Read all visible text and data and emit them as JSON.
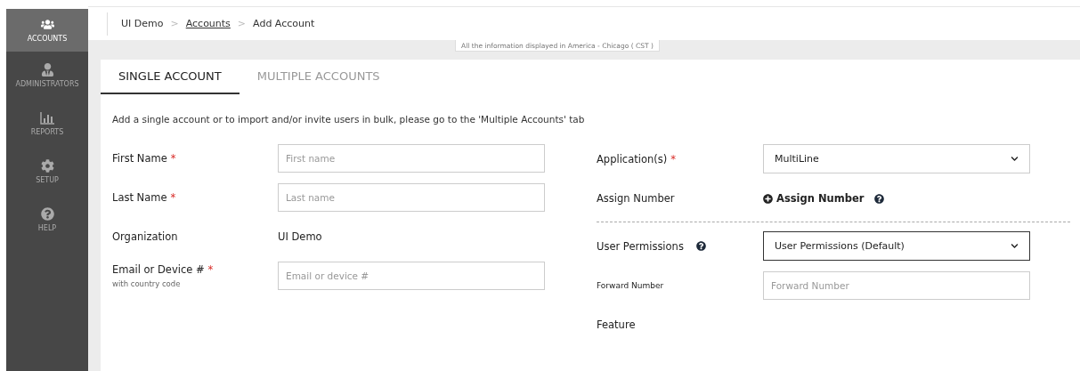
{
  "sidebar": {
    "items": [
      {
        "label": "ACCOUNTS",
        "selected": true
      },
      {
        "label": "ADMINISTRATORS",
        "selected": false
      },
      {
        "label": "REPORTS",
        "selected": false
      },
      {
        "label": "SETUP",
        "selected": false
      },
      {
        "label": "HELP",
        "selected": false
      }
    ]
  },
  "breadcrumb": [
    {
      "label": "UI Demo",
      "kind": "text"
    },
    {
      "separator": ">",
      "label": "Accounts",
      "kind": "link"
    },
    {
      "separator": ">",
      "label": "Add Account",
      "kind": "text"
    }
  ],
  "timezone_note": "All the information displayed in America - Chicago ( CST )",
  "tabs": [
    {
      "label": "SINGLE ACCOUNT",
      "selected": true
    },
    {
      "label": "MULTIPLE ACCOUNTS",
      "selected": false
    }
  ],
  "intro": "Add a single account or to import and/or invite users in bulk, please go to the 'Multiple Accounts' tab",
  "left_fields": [
    {
      "label": "First Name",
      "required_mark": "*",
      "kind": "input",
      "placeholder": "First name"
    },
    {
      "label": "Last Name",
      "required_mark": "*",
      "kind": "input",
      "placeholder": "Last name"
    },
    {
      "label": "Organization",
      "kind": "text",
      "value": "UI Demo"
    },
    {
      "label": "Email or Device #",
      "required_mark": "*",
      "hint": "with country code",
      "kind": "input",
      "placeholder": "Email or device #"
    }
  ],
  "right_fields": [
    {
      "label": "Application(s)",
      "required_mark": "*",
      "kind": "select",
      "value": "MultiLine"
    },
    {
      "label": "Assign Number",
      "kind": "action",
      "value": "Assign Number",
      "help": true
    },
    {
      "kind": "divider"
    },
    {
      "label": "User Permissions",
      "help_label": true,
      "kind": "select",
      "value": "User Permissions (Default)",
      "focused": true
    },
    {
      "label": "Forward Number",
      "small": true,
      "kind": "input",
      "placeholder": "Forward Number"
    },
    {
      "label": "Feature",
      "kind": "empty"
    }
  ]
}
